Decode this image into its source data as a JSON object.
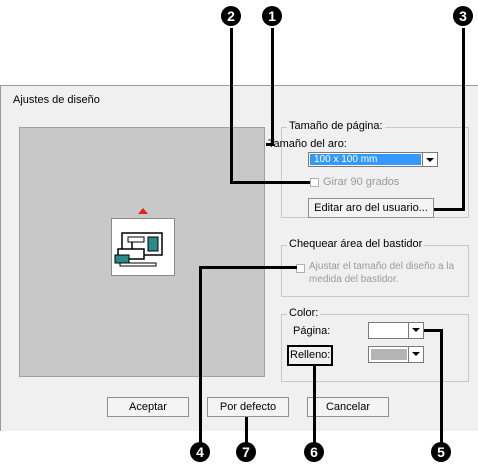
{
  "dialog": {
    "title": "Ajustes de diseño",
    "page_size_group": {
      "legend": "Tamaño de página:",
      "hoop_label": "Tamaño del aro:",
      "hoop_value": "100 x 100 mm",
      "rotate_label": "Girar 90 grados",
      "edit_button": "Editar aro del usuario..."
    },
    "check_area_group": {
      "legend": "Chequear área del bastidor",
      "fit_label_line1": "Ajustar el tamaño del diseño a la",
      "fit_label_line2": "medida del bastidor."
    },
    "color_group": {
      "legend": "Color:",
      "page_label": "Página:",
      "fill_label": "Relleno:"
    },
    "buttons": {
      "ok": "Aceptar",
      "default": "Por defecto",
      "cancel": "Cancelar"
    }
  },
  "callouts": {
    "c1": "1",
    "c2": "2",
    "c3": "3",
    "c4": "4",
    "c5": "5",
    "c6": "6",
    "c7": "7"
  },
  "colors": {
    "selection": "#3399ff",
    "preview_bg": "#c8c8c8",
    "page_color": "#ffffff",
    "fill_color": "#b4b4b4",
    "machine_teal": "#2a8a8a",
    "hoop_arrow": "#e02020"
  }
}
